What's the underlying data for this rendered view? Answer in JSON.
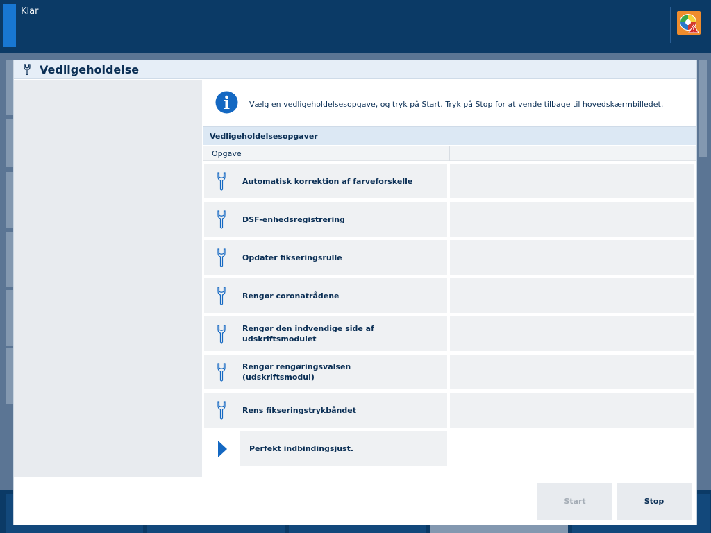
{
  "topbar": {
    "status": "Klar",
    "alert_icon": "color-alert-icon"
  },
  "dialog": {
    "title": "Vedligeholdelse",
    "header_icon": "wrench-icon",
    "info_icon": "info-icon",
    "info_text": "Vælg en vedligeholdelsesopgave, og tryk på Start. Tryk på Stop for at vende tilbage til hovedskærmbilledet.",
    "section_title": "Vedligeholdelsesopgaver",
    "column_header": "Opgave",
    "tasks": [
      {
        "label": "Automatisk korrektion af farveforskelle",
        "icon": "wrench-icon"
      },
      {
        "label": "DSF-enhedsregistrering",
        "icon": "wrench-icon"
      },
      {
        "label": "Opdater fikseringsrulle",
        "icon": "wrench-icon"
      },
      {
        "label": "Rengør coronatrådene",
        "icon": "wrench-icon"
      },
      {
        "label": "Rengør den indvendige side af udskriftsmodulet",
        "icon": "wrench-icon"
      },
      {
        "label": "Rengør rengøringsvalsen (udskriftsmodul)",
        "icon": "wrench-icon"
      },
      {
        "label": "Rens fikseringstrykbåndet",
        "icon": "wrench-icon"
      },
      {
        "label": "Perfekt indbindingsjust.",
        "icon": "arrow-right-icon",
        "selected": true
      }
    ],
    "buttons": {
      "start": "Start",
      "stop": "Stop"
    }
  },
  "colors": {
    "topbar": "#0b3a66",
    "accent": "#1877d2",
    "text": "#0b2f55",
    "alert": "#ef8c2d"
  }
}
